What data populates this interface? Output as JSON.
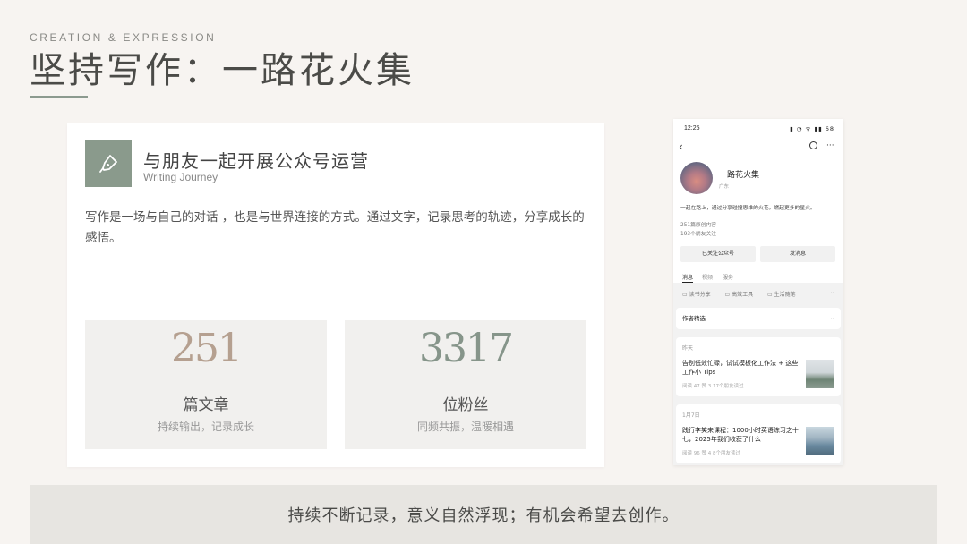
{
  "header": {
    "kicker": "CREATION & EXPRESSION",
    "title": "坚持写作：一路花火集"
  },
  "card": {
    "title": "与朋友一起开展公众号运营",
    "subtitle": "Writing Journey",
    "body": "写作是一场与自己的对话 ，也是与世界连接的方式。通过文字，记录思考的轨迹，分享成长的感悟。",
    "icon": "pen-nib-icon",
    "icon_bg": "#8a9a8c",
    "stats": [
      {
        "number": "251",
        "label": "篇文章",
        "desc": "持续输出，记录成长",
        "color": "#b5a090"
      },
      {
        "number": "3317",
        "label": "位粉丝",
        "desc": "同频共振，温暖相遇",
        "color": "#86958a"
      }
    ]
  },
  "phone": {
    "time": "12:25",
    "status_icons": "▮ ◔ ᯤ ▮▮ 68",
    "account_name": "一路花火集",
    "location": "广东",
    "bio": "一起在路上，通过分享碰撞思维的火花，燃起更多的星火。",
    "article_count": "251篇原创内容",
    "friends_follow": "193个朋友关注",
    "buttons": {
      "followed": "已关注公众号",
      "message": "发消息"
    },
    "tabs": [
      "消息",
      "视频",
      "服务"
    ],
    "categories": [
      "读书分享",
      "高效工具",
      "生活随笔"
    ],
    "author_pick": "作者精选",
    "articles": [
      {
        "date": "昨天",
        "title": "告别低效忙碌，试试模板化工作法 + 这些工作小 Tips",
        "meta": "阅读 47  赞 3  17个朋友读过"
      },
      {
        "date": "1月7日",
        "title": "践行李笑来课程：1000小时英语练习之十七，2025年我们收获了什么",
        "meta": "阅读 96  赞 4  8个朋友读过"
      }
    ]
  },
  "banner": {
    "text": "持续不断记录，意义自然浮现；有机会希望去创作。"
  }
}
